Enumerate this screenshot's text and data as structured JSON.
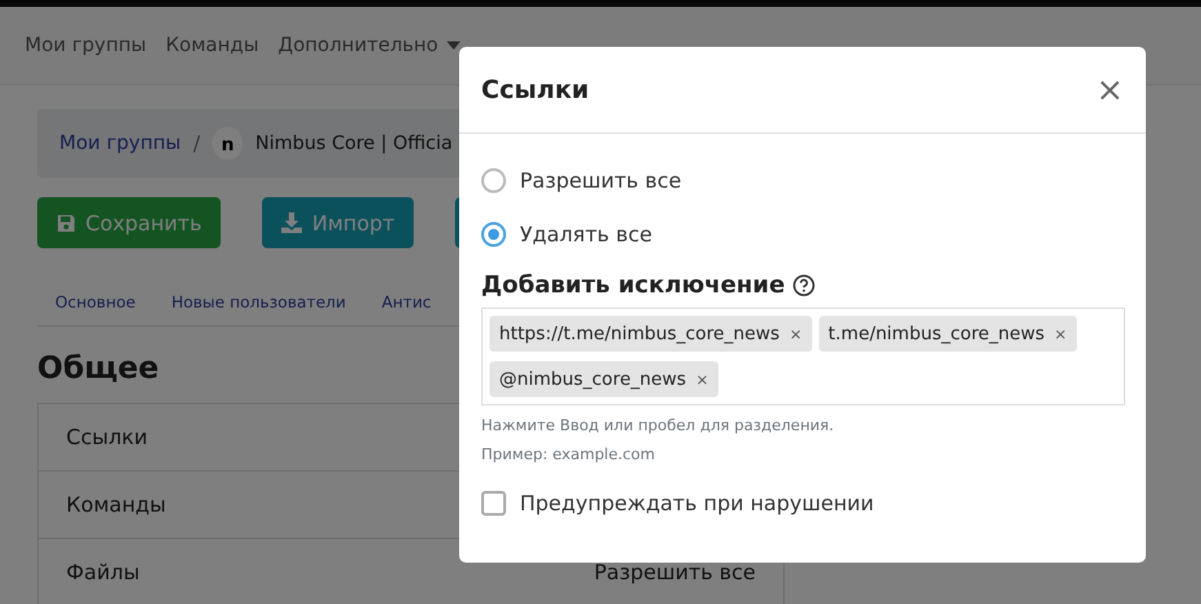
{
  "nav": {
    "items": [
      "Мои группы",
      "Команды",
      "Дополнительно"
    ]
  },
  "breadcrumb": {
    "link": "Мои группы",
    "separator": "/",
    "logo_letter": "n",
    "current": "Nimbus Core | Officia"
  },
  "actions": [
    {
      "kind": "save",
      "label": "Сохранить"
    },
    {
      "kind": "import",
      "label": "Импорт"
    },
    {
      "kind": "blank"
    }
  ],
  "tabs": [
    "Основное",
    "Новые пользователи",
    "Антис"
  ],
  "section": {
    "title": "Общее",
    "rows": [
      {
        "name": "Ссылки"
      },
      {
        "name": "Команды"
      },
      {
        "name": "Файлы",
        "value": "Разрешить все"
      }
    ]
  },
  "modal": {
    "title": "Ссылки",
    "close": "×",
    "options": [
      {
        "label": "Разрешить все",
        "selected": false
      },
      {
        "label": "Удалять все",
        "selected": true
      }
    ],
    "exceptions_title": "Добавить исключение",
    "tags": [
      {
        "text": "https://t.me/nimbus_core_news",
        "remove": "×"
      },
      {
        "text": "t.me/nimbus_core_news",
        "remove": "×"
      },
      {
        "text": "@nimbus_core_news",
        "remove": "×"
      }
    ],
    "hint": "Нажмите Ввод или пробел для разделения.",
    "example": "Пример: example.com",
    "warn": {
      "label": "Предупреждать при нарушении",
      "checked": false
    }
  }
}
